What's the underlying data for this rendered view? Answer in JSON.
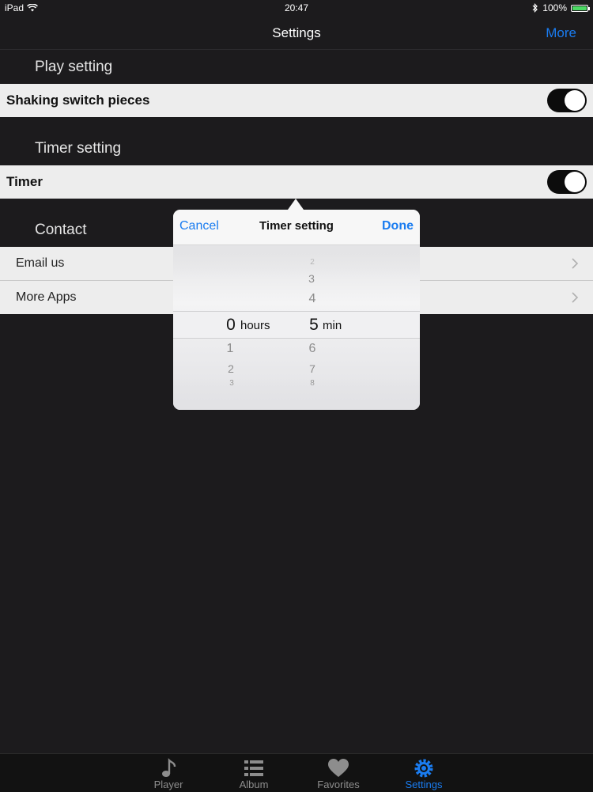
{
  "status_bar": {
    "carrier": "iPad",
    "time": "20:47",
    "battery": "100%"
  },
  "navbar": {
    "title": "Settings",
    "more_label": "More"
  },
  "sections": {
    "play": {
      "header": "Play setting",
      "row_label": "Shaking switch pieces",
      "toggle_on": true
    },
    "timer": {
      "header": "Timer setting",
      "row_label": "Timer",
      "toggle_on": true
    },
    "contact": {
      "header": "Contact",
      "items": [
        {
          "label": "Email us"
        },
        {
          "label": "More Apps"
        }
      ]
    }
  },
  "popover": {
    "cancel_label": "Cancel",
    "title": "Timer setting",
    "done_label": "Done",
    "hours": {
      "above": [],
      "selected": "0",
      "below": [
        "1",
        "2",
        "3"
      ],
      "unit": "hours"
    },
    "minutes": {
      "above": [
        "2",
        "3",
        "4"
      ],
      "selected": "5",
      "below": [
        "6",
        "7",
        "8"
      ],
      "unit": "min"
    }
  },
  "tabbar": {
    "tabs": [
      {
        "label": "Player",
        "icon": "music-note-icon"
      },
      {
        "label": "Album",
        "icon": "list-icon"
      },
      {
        "label": "Favorites",
        "icon": "heart-icon"
      },
      {
        "label": "Settings",
        "icon": "gear-icon"
      }
    ],
    "active_index": 3
  },
  "colors": {
    "accent": "#1a7cf0",
    "background": "#1c1b1d",
    "row": "#ededed"
  }
}
